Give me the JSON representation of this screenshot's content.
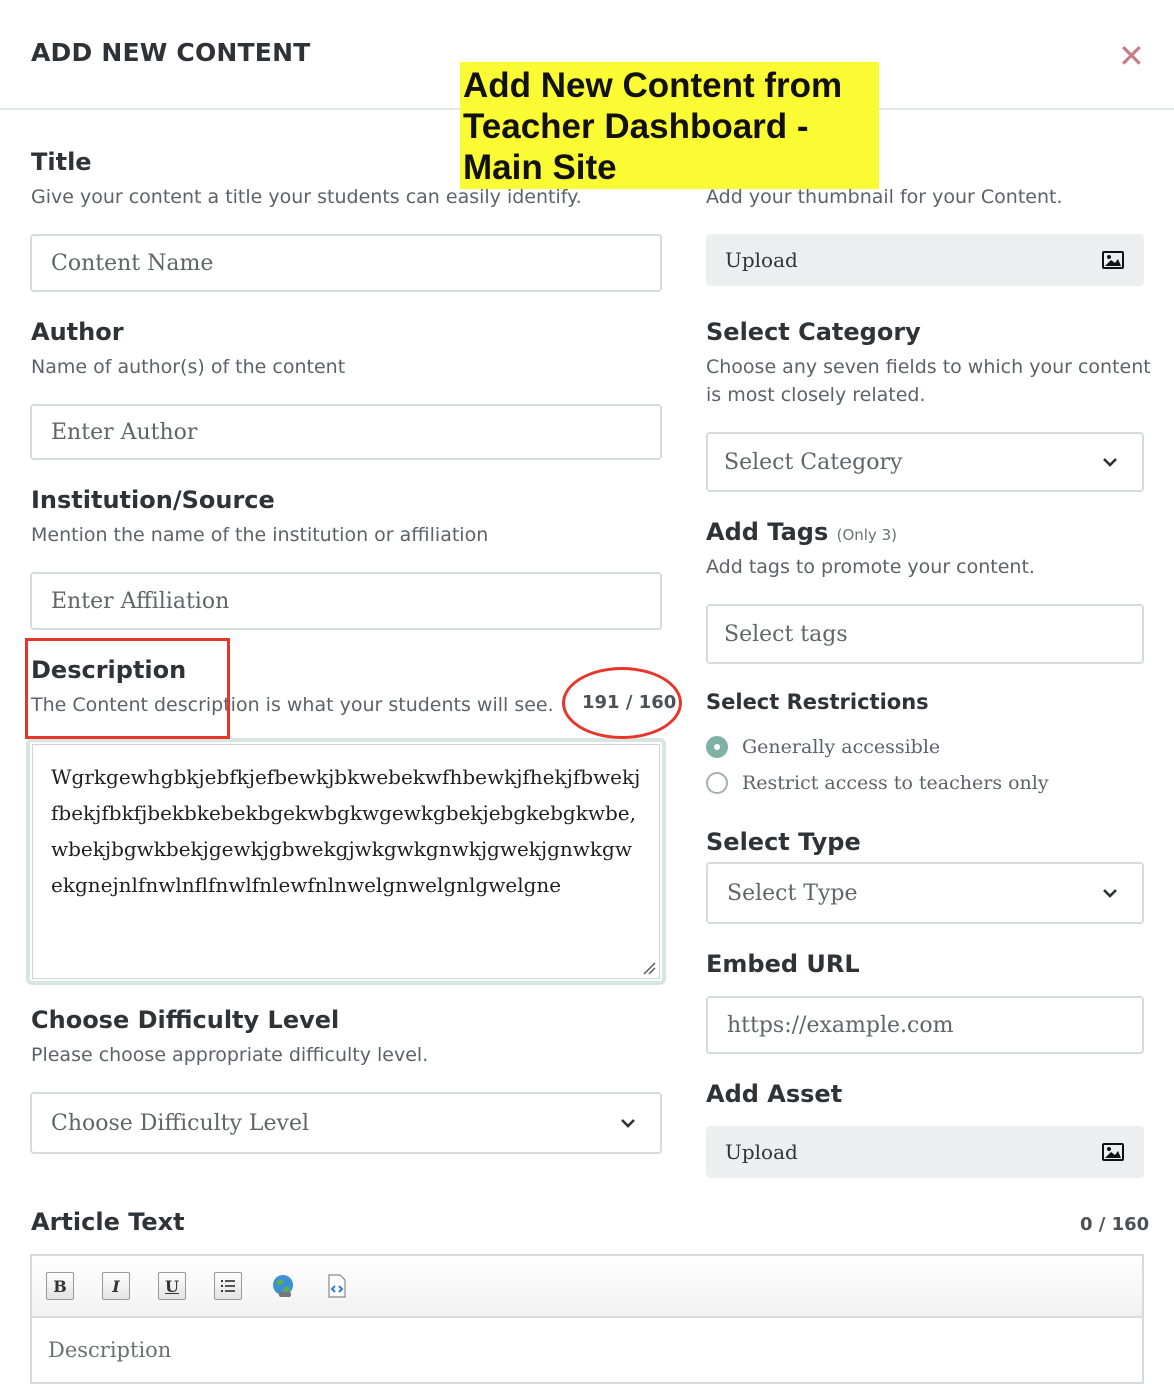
{
  "modal": {
    "title": "ADD NEW CONTENT",
    "close_glyph": "✕"
  },
  "annotation": {
    "lines": [
      "Add New Content from",
      "Teacher Dashboard -",
      "Main Site"
    ],
    "background": "#fbfb33"
  },
  "left": {
    "title": {
      "label": "Title",
      "help": "Give your content a title your students can easily identify.",
      "placeholder": "Content Name"
    },
    "author": {
      "label": "Author",
      "help": "Name of author(s) of the content",
      "placeholder": "Enter Author"
    },
    "institution": {
      "label": "Institution/Source",
      "help": "Mention the name of the institution or affiliation",
      "placeholder": "Enter Affiliation"
    },
    "description": {
      "label": "Description",
      "help": "The Content description is what your students will see.",
      "counter": "191 / 160",
      "value": "Wgrkgewhgbkjebfkjefbewkjbkwebekwfhbewkjfhekjfbwekjfbekjfbkfjbekbkebekbgekwbgkwgewkgbekjebgkebgkwbe,wbekjbgwkbekjgewkjgbwekgjwkgwkgnwkjgwekjgnwkgwekgnejnlfnwlnflfnwlfnlewfnlnwelgnwelgnlgwelgne"
    },
    "difficulty": {
      "label": "Choose Difficulty Level",
      "help": "Please choose appropriate difficulty level.",
      "placeholder": "Choose Difficulty Level"
    }
  },
  "right": {
    "thumbnail": {
      "help": "Add your thumbnail for your Content.",
      "button": "Upload",
      "icon": "image-icon"
    },
    "category": {
      "label": "Select Category",
      "help_line1": "Choose any seven fields to which your content",
      "help_line2": "is most closely related.",
      "placeholder": "Select Category"
    },
    "tags": {
      "label": "Add Tags",
      "note": "(Only 3)",
      "help": "Add tags to promote your content.",
      "placeholder": "Select tags"
    },
    "restrictions": {
      "label": "Select Restrictions",
      "options": [
        {
          "label": "Generally accessible",
          "selected": true
        },
        {
          "label": "Restrict access to teachers only",
          "selected": false
        }
      ]
    },
    "type": {
      "label": "Select Type",
      "placeholder": "Select Type"
    },
    "embed": {
      "label": "Embed URL",
      "placeholder": "https://example.com"
    },
    "asset": {
      "label": "Add Asset",
      "button": "Upload",
      "icon": "image-icon"
    }
  },
  "article": {
    "label": "Article Text",
    "counter": "0 / 160",
    "toolbar": {
      "bold": "B",
      "italic": "I",
      "underline": "U"
    },
    "placeholder": "Description"
  },
  "colors": {
    "highlight_red": "#e8352c",
    "radio_selected": "#7fb1a5",
    "close_icon": "#c97a86"
  }
}
